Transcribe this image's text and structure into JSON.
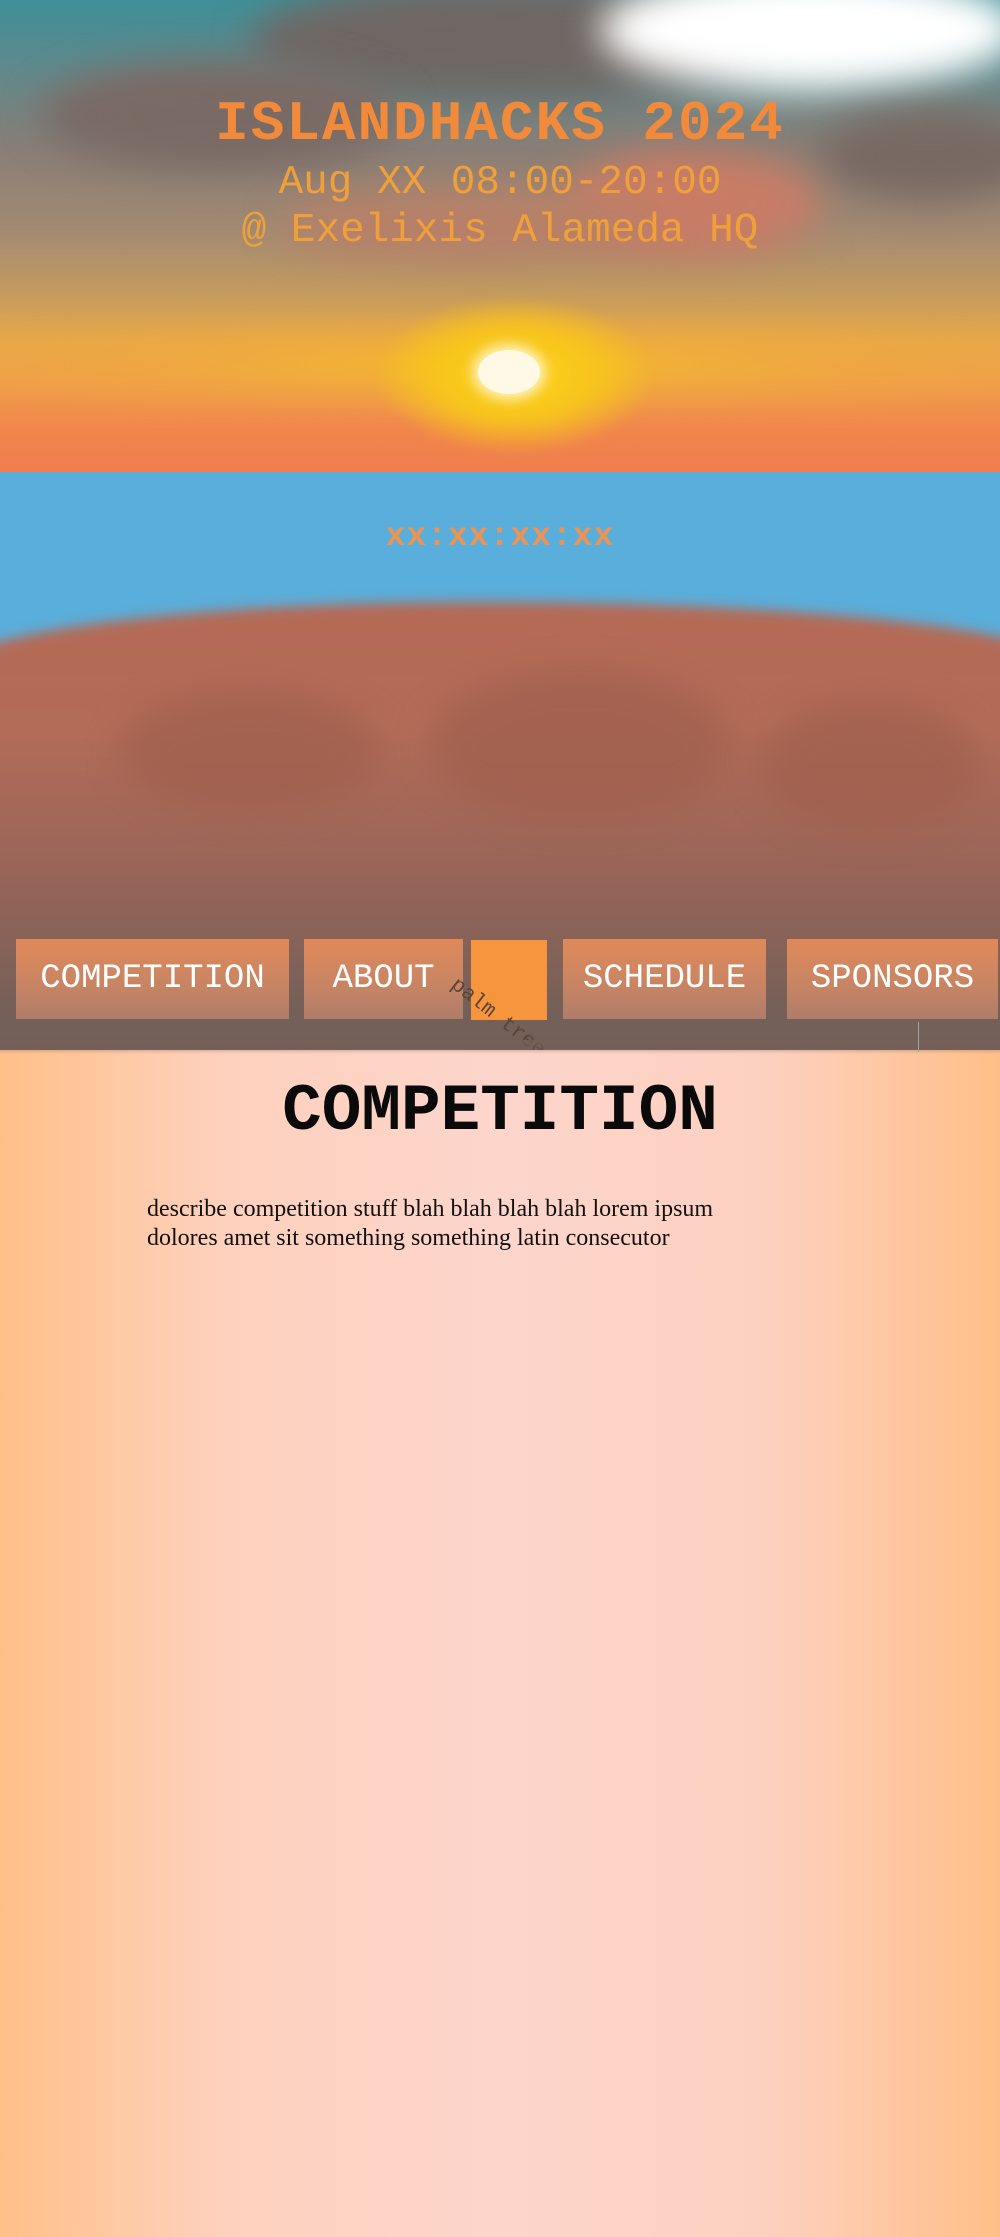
{
  "hero": {
    "title": "ISLANDHACKS 2024",
    "date": "Aug XX 08:00-20:00",
    "venue": "@ Exelixis Alameda HQ"
  },
  "countdown": "xx:xx:xx:xx",
  "nav": {
    "items": [
      {
        "label": "COMPETITION"
      },
      {
        "label": "ABOUT"
      },
      {
        "label": "SCHEDULE"
      },
      {
        "label": "SPONSORS"
      }
    ],
    "palm_tree_label": "palm tree"
  },
  "section": {
    "title": "COMPETITION",
    "body_line1": "describe competition stuff blah blah blah blah lorem ipsum",
    "body_line2": "dolores amet sit something something latin consecutor"
  },
  "colors": {
    "accent_orange": "#f28a3c",
    "nav_button": "#d9895d",
    "ocean": "#5aaedb",
    "island": "#b56a55",
    "peach_background": "#fdd5cb"
  }
}
